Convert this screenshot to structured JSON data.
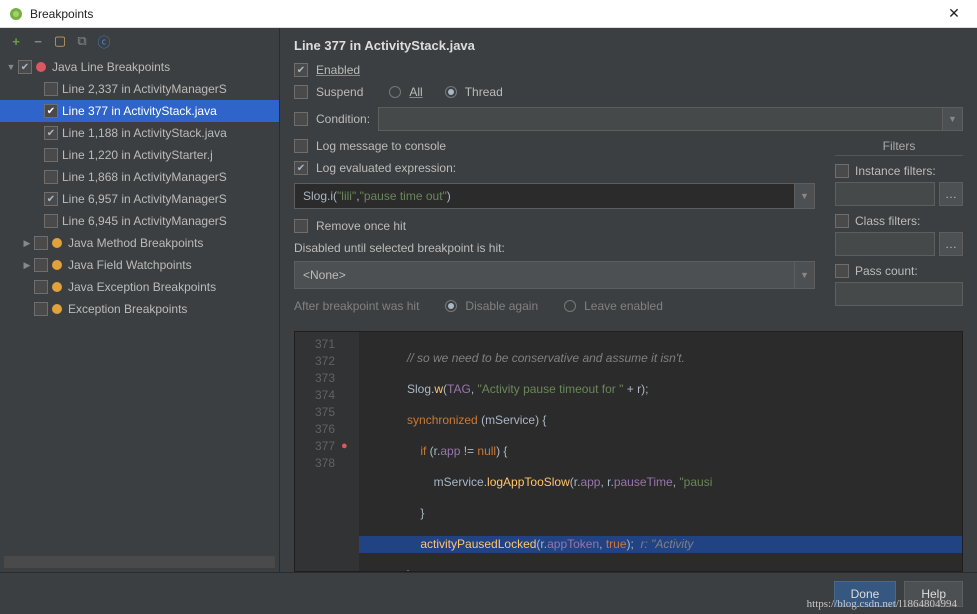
{
  "window": {
    "title": "Breakpoints"
  },
  "tree": {
    "groups": [
      {
        "label": "Java Line Breakpoints",
        "checked": true,
        "dot": "red",
        "items": [
          {
            "label": "Line 2,337 in ActivityManagerS",
            "checked": false
          },
          {
            "label": "Line 377 in ActivityStack.java",
            "checked": true,
            "selected": true
          },
          {
            "label": "Line 1,188 in ActivityStack.java",
            "checked": true
          },
          {
            "label": "Line 1,220 in ActivityStarter.j",
            "checked": false
          },
          {
            "label": "Line 1,868 in ActivityManagerS",
            "checked": false
          },
          {
            "label": "Line 6,957 in ActivityManagerS",
            "checked": true
          },
          {
            "label": "Line 6,945 in ActivityManagerS",
            "checked": false
          }
        ]
      },
      {
        "label": "Java Method Breakpoints",
        "dot": "orange"
      },
      {
        "label": "Java Field Watchpoints",
        "dot": "orange"
      },
      {
        "label": "Java Exception Breakpoints",
        "dot": "orange"
      },
      {
        "label": "Exception Breakpoints",
        "dot": "orange"
      }
    ]
  },
  "details": {
    "title": "Line 377 in ActivityStack.java",
    "enabled_label": "Enabled",
    "suspend_label": "Suspend",
    "all_label": "All",
    "thread_label": "Thread",
    "condition_label": "Condition:",
    "log_message_label": "Log message to console",
    "log_expr_label": "Log evaluated expression:",
    "expr_fn": "Slog.i",
    "expr_arg1": "\"lili\"",
    "expr_arg2": "\"pause time out\"",
    "remove_once_label": "Remove once hit",
    "disabled_until_label": "Disabled until selected breakpoint is hit:",
    "none_option": "<None>",
    "after_hit_label": "After breakpoint was hit",
    "disable_again_label": "Disable again",
    "leave_enabled_label": "Leave enabled",
    "filters_title": "Filters",
    "instance_filters_label": "Instance filters:",
    "class_filters_label": "Class filters:",
    "pass_count_label": "Pass count:"
  },
  "code": {
    "lines": [
      371,
      372,
      373,
      374,
      375,
      376,
      377,
      378
    ],
    "l371": "            // so we need to be conservative and assume it isn't.",
    "l372_a": "            Slog.",
    "l372_b": "w",
    "l372_c": "(",
    "l372_d": "TAG",
    "l372_e": ", ",
    "l372_f": "\"Activity pause timeout for \"",
    "l372_g": " + r);",
    "l373_a": "            ",
    "l373_b": "synchronized",
    "l373_c": " (mService) {",
    "l374_a": "                ",
    "l374_b": "if",
    "l374_c": " (r.",
    "l374_d": "app",
    "l374_e": " != ",
    "l374_f": "null",
    "l374_g": ") {",
    "l375_a": "                    mService.",
    "l375_b": "logAppTooSlow",
    "l375_c": "(r.",
    "l375_d": "app",
    "l375_e": ", r.",
    "l375_f": "pauseTime",
    "l375_g": ", ",
    "l375_h": "\"pausi",
    "l376": "                }",
    "l377_a": "                ",
    "l377_b": "activityPausedLocked",
    "l377_c": "(r.",
    "l377_d": "appToken",
    "l377_e": ", ",
    "l377_f": "true",
    "l377_g": ");  ",
    "l377_h": "r: \"Activity",
    "l378": "            }"
  },
  "buttons": {
    "done": "Done",
    "help": "Help"
  },
  "watermark": "https://blog.csdn.net/l1864804994"
}
